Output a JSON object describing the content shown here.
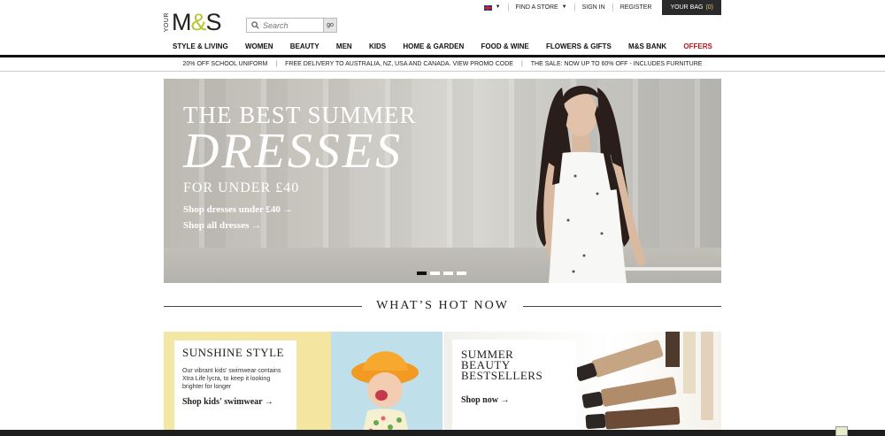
{
  "header": {
    "logo_your": "YOUR",
    "logo_m": "M",
    "logo_amp": "&",
    "logo_s": "S",
    "search_placeholder": "Search",
    "search_go": "go",
    "find_store": "FIND A STORE",
    "sign_in": "SIGN IN",
    "register": "REGISTER",
    "bag_label": "YOUR BAG",
    "bag_count": "(0)"
  },
  "nav": [
    {
      "label": "STYLE & LIVING"
    },
    {
      "label": "WOMEN"
    },
    {
      "label": "BEAUTY"
    },
    {
      "label": "MEN"
    },
    {
      "label": "KIDS"
    },
    {
      "label": "HOME & GARDEN"
    },
    {
      "label": "FOOD & WINE"
    },
    {
      "label": "FLOWERS & GIFTS"
    },
    {
      "label": "M&S BANK"
    },
    {
      "label": "OFFERS"
    }
  ],
  "promo": {
    "item1": "20% OFF SCHOOL UNIFORM",
    "item2": "FREE DELIVERY TO AUSTRALIA, NZ, USA AND CANADA. VIEW PROMO CODE",
    "item3": "THE SALE: NOW UP TO 60% OFF - INCLUDES FURNITURE",
    "sep": "|"
  },
  "hero": {
    "line1": "THE BEST SUMMER",
    "line2": "DRESSES",
    "line3": "FOR UNDER £40",
    "link1": "Shop dresses under £40 →",
    "link2": "Shop all dresses →",
    "active_slide": 1,
    "slides": 4
  },
  "section": {
    "title": "WHAT’S HOT NOW"
  },
  "tiles": {
    "t1_title": "SUNSHINE STYLE",
    "t1_desc": "Our vibrant kids' swimwear contains Xtra Life lycra, to keep it looking brighter for longer",
    "t1_link": "Shop kids' swimwear →",
    "t2_title_1": "SUMMER",
    "t2_title_2": "BEAUTY",
    "t2_title_3": "BESTSELLERS",
    "t2_link": "Shop now →"
  },
  "colors": {
    "offers": "#c0111f",
    "bag_bg": "#2a2a2a",
    "logo_amp": "#b6c62d"
  }
}
